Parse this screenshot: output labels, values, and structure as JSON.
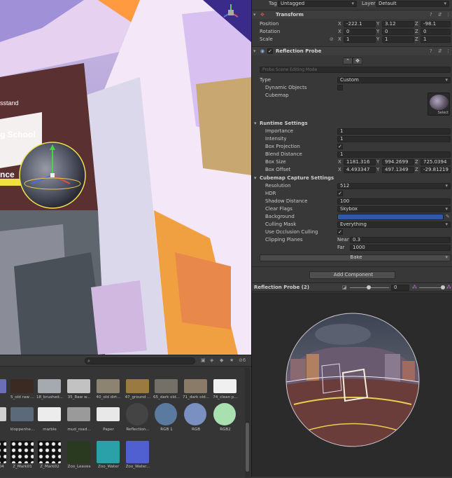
{
  "scene": {
    "sign_text_1": "sstand",
    "sign_text_2": "g School",
    "sign_text_3": "nce"
  },
  "header": {
    "tag_label": "Tag",
    "tag_value": "Untagged",
    "layer_label": "Layer",
    "layer_value": "Default"
  },
  "transform": {
    "title": "Transform",
    "position_label": "Position",
    "position": {
      "x": "-222.1",
      "y": "3.12",
      "z": "-98.1"
    },
    "rotation_label": "Rotation",
    "rotation": {
      "x": "0",
      "y": "0",
      "z": "0"
    },
    "scale_label": "Scale",
    "scale": {
      "x": "1",
      "y": "1",
      "z": "1"
    }
  },
  "probe": {
    "title": "Reflection Probe",
    "editing_mode": "Probe Scene Editing Mode",
    "type_label": "Type",
    "type_value": "Custom",
    "dynamic_label": "Dynamic Objects",
    "cubemap_label": "Cubemap",
    "select_label": "Select",
    "runtime_title": "Runtime Settings",
    "importance_label": "Importance",
    "importance": "1",
    "intensity_label": "Intensity",
    "intensity": "1",
    "boxproj_label": "Box Projection",
    "blend_label": "Blend Distance",
    "blend": "1",
    "boxsize_label": "Box Size",
    "boxsize": {
      "x": "1181.316",
      "y": "994.2699",
      "z": "725.0394"
    },
    "boxoffset_label": "Box Offset",
    "boxoffset": {
      "x": "4.493347",
      "y": "497.1349",
      "z": "-29.81219"
    },
    "capture_title": "Cubemap Capture Settings",
    "resolution_label": "Resolution",
    "resolution": "512",
    "hdr_label": "HDR",
    "shadow_label": "Shadow Distance",
    "shadow": "100",
    "clear_label": "Clear Flags",
    "clear": "Skybox",
    "background_label": "Background",
    "background_color": "#2f5aa6",
    "culling_label": "Culling Mask",
    "culling": "Everything",
    "occlusion_label": "Use Occlusion Culling",
    "clipping_label": "Clipping Planes",
    "near_label": "Near",
    "near": "0.3",
    "far_label": "Far",
    "far": "1000",
    "bake_label": "Bake"
  },
  "add_component": "Add Component",
  "preview": {
    "title": "Reflection Probe (2)",
    "exposure": "0"
  },
  "project": {
    "count": "6",
    "assets": [
      {
        "name": "",
        "color": "#6a6fb8"
      },
      {
        "name": "5_old raw ...",
        "color": "#3a2a22"
      },
      {
        "name": "18_brushed...",
        "color": "#a4aab0"
      },
      {
        "name": "35_Raw w...",
        "color": "#c2c2c2"
      },
      {
        "name": "40_old dirt...",
        "color": "#8c8470"
      },
      {
        "name": "47_ground ...",
        "color": "#9a7a40"
      },
      {
        "name": "65_dark old...",
        "color": "#747068"
      },
      {
        "name": "71_dark old...",
        "color": "#8a7a68"
      },
      {
        "name": "74_clean p...",
        "color": "#f0f0f0"
      },
      {
        "name": "",
        "color": "#d0d0d0"
      },
      {
        "name": "kloppenhe...",
        "color": "#5a6a7a"
      },
      {
        "name": "marble",
        "color": "#ececec"
      },
      {
        "name": "mud_road...",
        "color": "#9a9a9a"
      },
      {
        "name": "Paper",
        "color": "#e8e8e8"
      },
      {
        "name": "Reflection...",
        "color": "#444"
      },
      {
        "name": "RGB 1",
        "color": "#5a7aa0"
      },
      {
        "name": "RGB",
        "color": "#7a90c0"
      },
      {
        "name": "RGB2",
        "color": "#a8e0b0"
      },
      {
        "name": "Z_Line04",
        "color": "#111"
      },
      {
        "name": "Z_Mark01",
        "color": "#111"
      },
      {
        "name": "Z_Mark02",
        "color": "#111"
      },
      {
        "name": "Zoo_Leaves",
        "color": "#2a3a20"
      },
      {
        "name": "Zoo_Water",
        "color": "#2aa0a8"
      },
      {
        "name": "Zoo_Water...",
        "color": "#5060d0"
      }
    ]
  }
}
